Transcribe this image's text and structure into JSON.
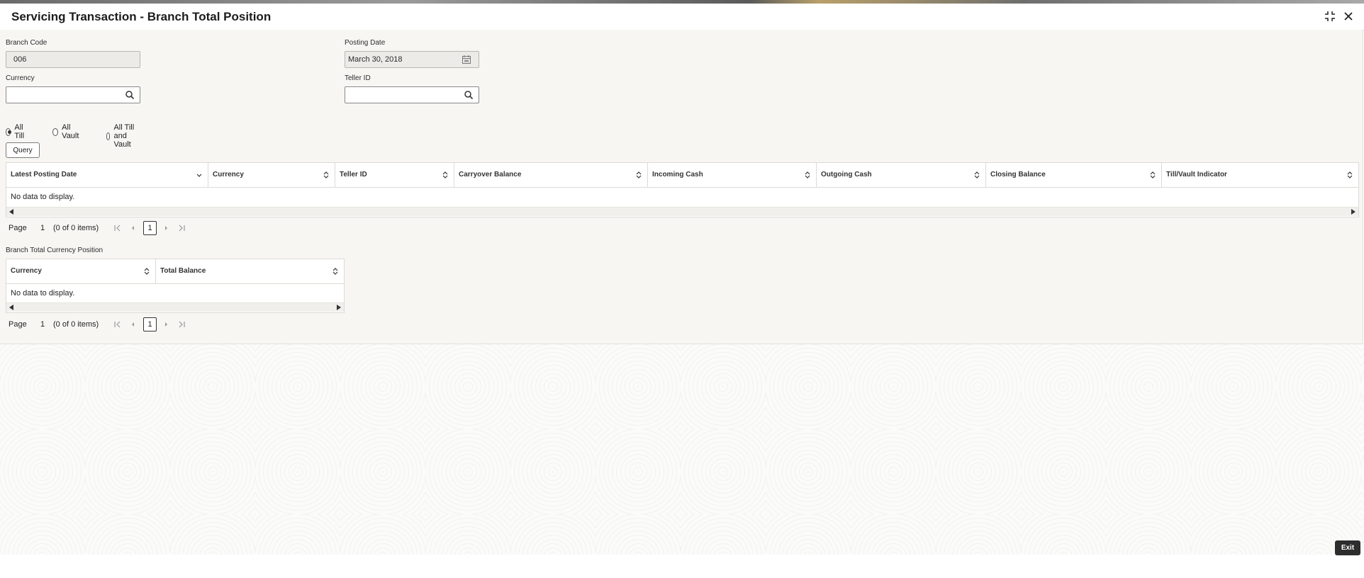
{
  "window": {
    "title": "Servicing Transaction - Branch Total Position"
  },
  "form": {
    "branch_code_label": "Branch Code",
    "branch_code_value": "006",
    "posting_date_label": "Posting Date",
    "posting_date_value": "March 30, 2018",
    "currency_label": "Currency",
    "currency_value": "",
    "teller_id_label": "Teller ID",
    "teller_id_value": ""
  },
  "radios": [
    {
      "label": "All Till",
      "selected": true
    },
    {
      "label": "All Vault",
      "selected": false
    },
    {
      "label": "All Till and Vault",
      "selected": false
    }
  ],
  "query_button": "Query",
  "position_table": {
    "columns": [
      "Latest Posting Date",
      "Currency",
      "Teller ID",
      "Carryover Balance",
      "Incoming Cash",
      "Outgoing Cash",
      "Closing Balance",
      "Till/Vault Indicator"
    ],
    "empty_text": "No data to display.",
    "pager": {
      "page_label": "Page",
      "page_number": "1",
      "items_text": "(0 of 0 items)",
      "current": "1"
    }
  },
  "currency_position": {
    "title": "Branch Total Currency Position",
    "columns": [
      "Currency",
      "Total Balance"
    ],
    "empty_text": "No data to display.",
    "pager": {
      "page_label": "Page",
      "page_number": "1",
      "items_text": "(0 of 0 items)",
      "current": "1"
    }
  },
  "footer": {
    "exit_label": "Exit"
  },
  "colors": {
    "panel_bg": "#f7f6f3",
    "exit_bg": "#2d2d2d",
    "border": "#dcdad5"
  },
  "icons": [
    "maximize-icon",
    "close-icon",
    "calendar-icon",
    "search-icon",
    "sort-icon",
    "first-page-icon",
    "prev-page-icon",
    "next-page-icon",
    "last-page-icon"
  ]
}
